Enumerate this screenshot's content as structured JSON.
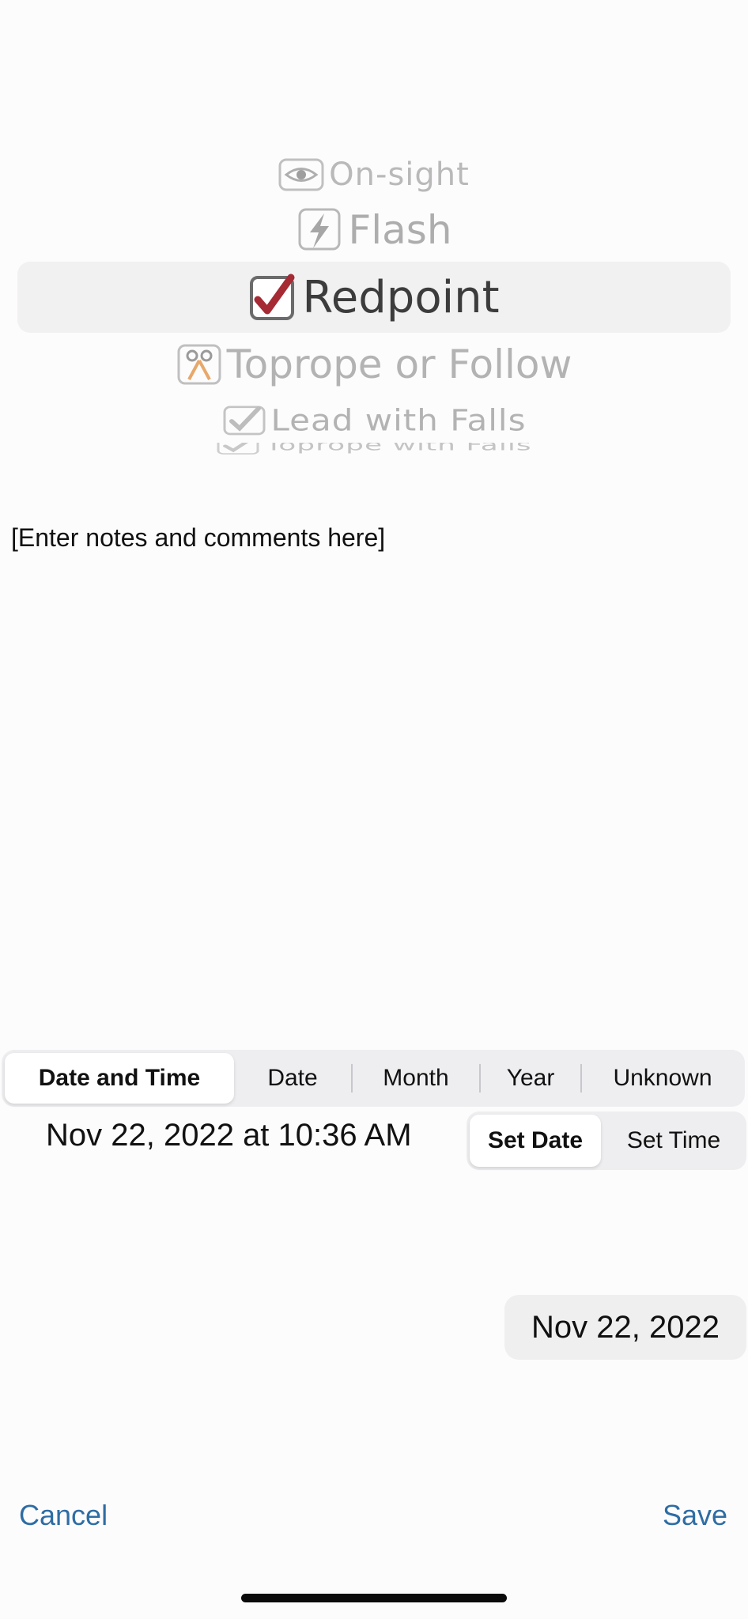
{
  "picker": {
    "options": [
      {
        "label": "On-sight",
        "icon": "eye-icon"
      },
      {
        "label": "Flash",
        "icon": "lightning-icon"
      },
      {
        "label": "Redpoint",
        "icon": "red-checkmark-icon"
      },
      {
        "label": "Toprope or Follow",
        "icon": "rope-carabiner-icon"
      },
      {
        "label": "Lead with Falls",
        "icon": "gray-checkmark-icon"
      },
      {
        "label": "Toprope with Falls",
        "icon": "gray-checkmark-icon"
      }
    ],
    "selected": "Redpoint"
  },
  "notes": {
    "placeholder": "[Enter notes and comments here]"
  },
  "date_mode": {
    "options": [
      "Date and Time",
      "Date",
      "Month",
      "Year",
      "Unknown"
    ],
    "selected": "Date and Time"
  },
  "current_datetime": "Nov 22, 2022 at 10:36 AM",
  "set_mode": {
    "options": [
      "Set Date",
      "Set Time"
    ],
    "selected": "Set Date"
  },
  "date_button": "Nov 22, 2022",
  "actions": {
    "cancel": "Cancel",
    "save": "Save"
  },
  "colors": {
    "accent": "#2e6da4",
    "check_red": "#a52a34"
  }
}
